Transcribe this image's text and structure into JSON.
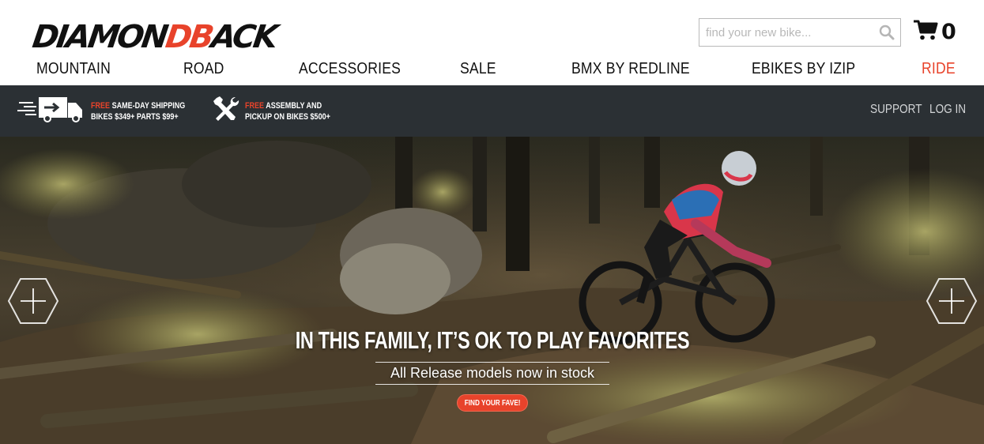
{
  "brand": {
    "logo_part1": "DIAMON",
    "logo_part2": "DB",
    "logo_part3": "ACK",
    "accent_color": "#e8432b",
    "bar_color": "#2b3034"
  },
  "search": {
    "placeholder": "find your new bike...",
    "value": "",
    "icon": "search-icon"
  },
  "cart": {
    "icon": "cart-icon",
    "count": "0"
  },
  "nav": {
    "items": [
      {
        "label": "MOUNTAIN"
      },
      {
        "label": "ROAD"
      },
      {
        "label": "ACCESSORIES"
      },
      {
        "label": "SALE"
      },
      {
        "label": "BMX BY REDLINE"
      },
      {
        "label": "EBIKES BY IZIP"
      },
      {
        "label": "RIDE",
        "color": "#e8432b"
      }
    ]
  },
  "promos": {
    "shipping": {
      "icon": "delivery-truck-icon",
      "free": "FREE",
      "line1": "SAME-DAY SHIPPING",
      "line2": "BIKES $349+ PARTS $99+"
    },
    "assembly": {
      "icon": "tools-icon",
      "free": "FREE",
      "line1": "ASSEMBLY AND",
      "line2": "PICKUP ON BIKES $500+"
    }
  },
  "utility": {
    "support": "SUPPORT",
    "login": "LOG IN"
  },
  "hero": {
    "title": "IN THIS FAMILY, IT’S OK TO PLAY FAVORITES",
    "subtitle": "All Release models now in stock",
    "cta": "FIND YOUR FAVE!",
    "prev_icon": "hexagon-plus-icon",
    "next_icon": "hexagon-plus-icon"
  }
}
